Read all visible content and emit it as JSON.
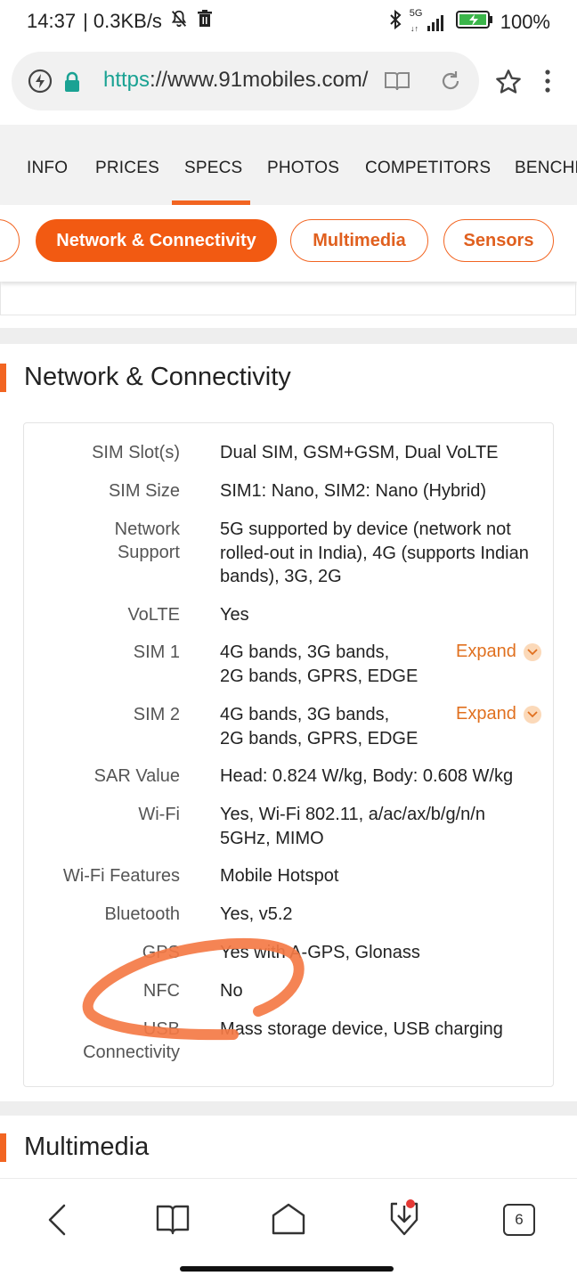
{
  "status": {
    "time": "14:37",
    "speed": "| 0.3KB/s",
    "network": "5G",
    "battery": "100%"
  },
  "browser": {
    "url_scheme": "https",
    "url_rest": "://www.91mobiles.com/"
  },
  "tabs": [
    "INFO",
    "PRICES",
    "SPECS",
    "PHOTOS",
    "COMPETITORS",
    "BENCHM"
  ],
  "active_tab": "SPECS",
  "chips": [
    "Network & Connectivity",
    "Multimedia",
    "Sensors"
  ],
  "active_chip": "Network & Connectivity",
  "section_title": "Network & Connectivity",
  "specs": [
    {
      "label": [
        "SIM Slot(s)"
      ],
      "value": [
        "Dual SIM, GSM+GSM, Dual VoLTE"
      ]
    },
    {
      "label": [
        "SIM Size"
      ],
      "value": [
        "SIM1: Nano, SIM2: Nano (Hybrid)"
      ]
    },
    {
      "label": [
        "Network",
        "Support"
      ],
      "value": [
        "5G supported by device (network not",
        "rolled-out in India), 4G (supports Indian",
        "bands), 3G, 2G"
      ]
    },
    {
      "label": [
        "VoLTE"
      ],
      "value": [
        "Yes"
      ]
    },
    {
      "label": [
        "SIM 1"
      ],
      "value": [
        "4G bands, 3G bands,",
        "2G bands, GPRS, EDGE"
      ],
      "expand": "Expand"
    },
    {
      "label": [
        "SIM 2"
      ],
      "value": [
        "4G bands, 3G bands,",
        "2G bands, GPRS, EDGE"
      ],
      "expand": "Expand"
    },
    {
      "label": [
        "SAR Value"
      ],
      "value": [
        "Head: 0.824 W/kg, Body: 0.608 W/kg"
      ]
    },
    {
      "label": [
        "Wi-Fi"
      ],
      "value": [
        "Yes, Wi-Fi 802.11, a/ac/ax/b/g/n/n",
        "5GHz, MIMO"
      ]
    },
    {
      "label": [
        "Wi-Fi Features"
      ],
      "value": [
        "Mobile Hotspot"
      ]
    },
    {
      "label": [
        "Bluetooth"
      ],
      "value": [
        "Yes, v5.2"
      ]
    },
    {
      "label": [
        "GPS"
      ],
      "value": [
        "Yes with A-GPS, Glonass"
      ]
    },
    {
      "label": [
        "NFC"
      ],
      "value": [
        "No"
      ]
    },
    {
      "label": [
        "USB",
        "Connectivity"
      ],
      "value": [
        "Mass storage device, USB charging"
      ]
    }
  ],
  "next_section_title": "Multimedia",
  "bottom_nav": {
    "tab_count": "6"
  },
  "colors": {
    "accent": "#f26522",
    "url_green": "#1aa293",
    "annotation": "#f47a45"
  }
}
